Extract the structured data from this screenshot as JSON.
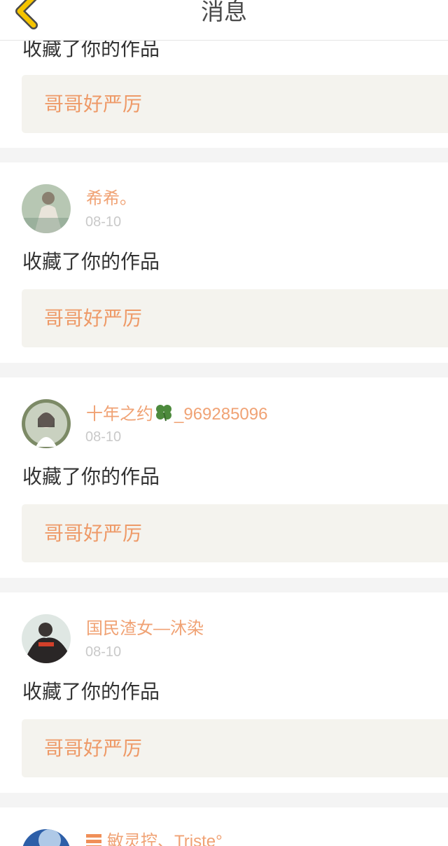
{
  "header": {
    "title": "消息"
  },
  "items": [
    {
      "action": "收藏了你的作品",
      "work_title": "哥哥好严厉"
    },
    {
      "username": "希希。",
      "date": "08-10",
      "action": "收藏了你的作品",
      "work_title": "哥哥好严厉",
      "avatar_color": "#b7c7b3"
    },
    {
      "username_prefix": "十年之约",
      "username_suffix": "_969285096",
      "date": "08-10",
      "action": "收藏了你的作品",
      "work_title": "哥哥好严厉",
      "avatar_color": "#c9d1c0"
    },
    {
      "username": "国民渣女—沐染",
      "date": "08-10",
      "action": "收藏了你的作品",
      "work_title": "哥哥好严厉",
      "avatar_color": "#2a2626"
    },
    {
      "username": "敏灵控、Triste°",
      "avatar_color": "#2d5fa8"
    }
  ],
  "colors": {
    "accent": "#f0a274",
    "work_bg": "#f4f3ee",
    "separator": "#f4f4f4",
    "back_icon": "#f5c400"
  }
}
